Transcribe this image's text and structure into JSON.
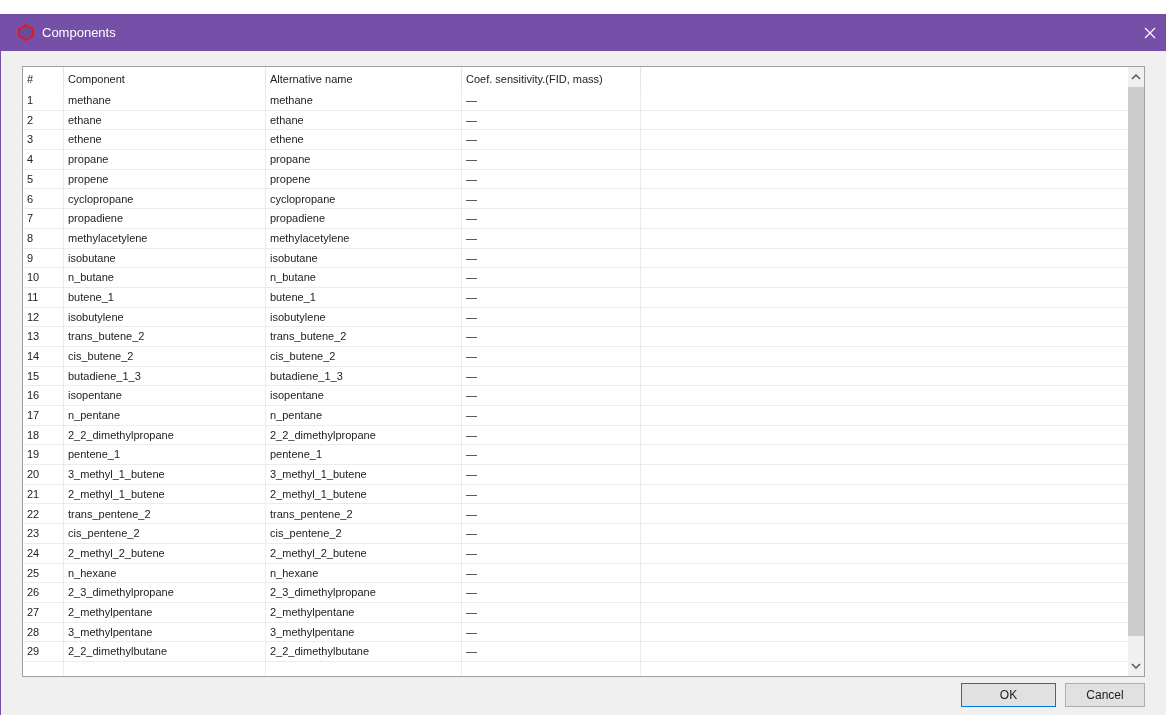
{
  "window": {
    "title": "Components"
  },
  "table": {
    "columns": [
      "#",
      "Component",
      "Alternative name",
      "Coef. sensitivity.(FID, mass)"
    ],
    "rows": [
      [
        "1",
        "methane",
        "methane",
        "—"
      ],
      [
        "2",
        "ethane",
        "ethane",
        "—"
      ],
      [
        "3",
        "ethene",
        "ethene",
        "—"
      ],
      [
        "4",
        "propane",
        "propane",
        "—"
      ],
      [
        "5",
        "propene",
        "propene",
        "—"
      ],
      [
        "6",
        "cyclopropane",
        "cyclopropane",
        "—"
      ],
      [
        "7",
        "propadiene",
        "propadiene",
        "—"
      ],
      [
        "8",
        "methylacetylene",
        "methylacetylene",
        "—"
      ],
      [
        "9",
        "isobutane",
        "isobutane",
        "—"
      ],
      [
        "10",
        "n_butane",
        "n_butane",
        "—"
      ],
      [
        "11",
        "butene_1",
        "butene_1",
        "—"
      ],
      [
        "12",
        "isobutylene",
        "isobutylene",
        "—"
      ],
      [
        "13",
        "trans_butene_2",
        "trans_butene_2",
        "—"
      ],
      [
        "14",
        "cis_butene_2",
        "cis_butene_2",
        "—"
      ],
      [
        "15",
        "butadiene_1_3",
        "butadiene_1_3",
        "—"
      ],
      [
        "16",
        "isopentane",
        "isopentane",
        "—"
      ],
      [
        "17",
        "n_pentane",
        "n_pentane",
        "—"
      ],
      [
        "18",
        "2_2_dimethylpropane",
        "2_2_dimethylpropane",
        "—"
      ],
      [
        "19",
        "pentene_1",
        "pentene_1",
        "—"
      ],
      [
        "20",
        "3_methyl_1_butene",
        "3_methyl_1_butene",
        "—"
      ],
      [
        "21",
        "2_methyl_1_butene",
        "2_methyl_1_butene",
        "—"
      ],
      [
        "22",
        "trans_pentene_2",
        "trans_pentene_2",
        "—"
      ],
      [
        "23",
        "cis_pentene_2",
        "cis_pentene_2",
        "—"
      ],
      [
        "24",
        "2_methyl_2_butene",
        "2_methyl_2_butene",
        "—"
      ],
      [
        "25",
        "n_hexane",
        "n_hexane",
        "—"
      ],
      [
        "26",
        "2_3_dimethylpropane",
        "2_3_dimethylpropane",
        "—"
      ],
      [
        "27",
        "2_methylpentane",
        "2_methylpentane",
        "—"
      ],
      [
        "28",
        "3_methylpentane",
        "3_methylpentane",
        "—"
      ],
      [
        "29",
        "2_2_dimethylbutane",
        "2_2_dimethylbutane",
        "—"
      ]
    ]
  },
  "buttons": [
    {
      "label": "OK",
      "selected": true
    },
    {
      "label": "Cancel",
      "selected": false
    }
  ]
}
